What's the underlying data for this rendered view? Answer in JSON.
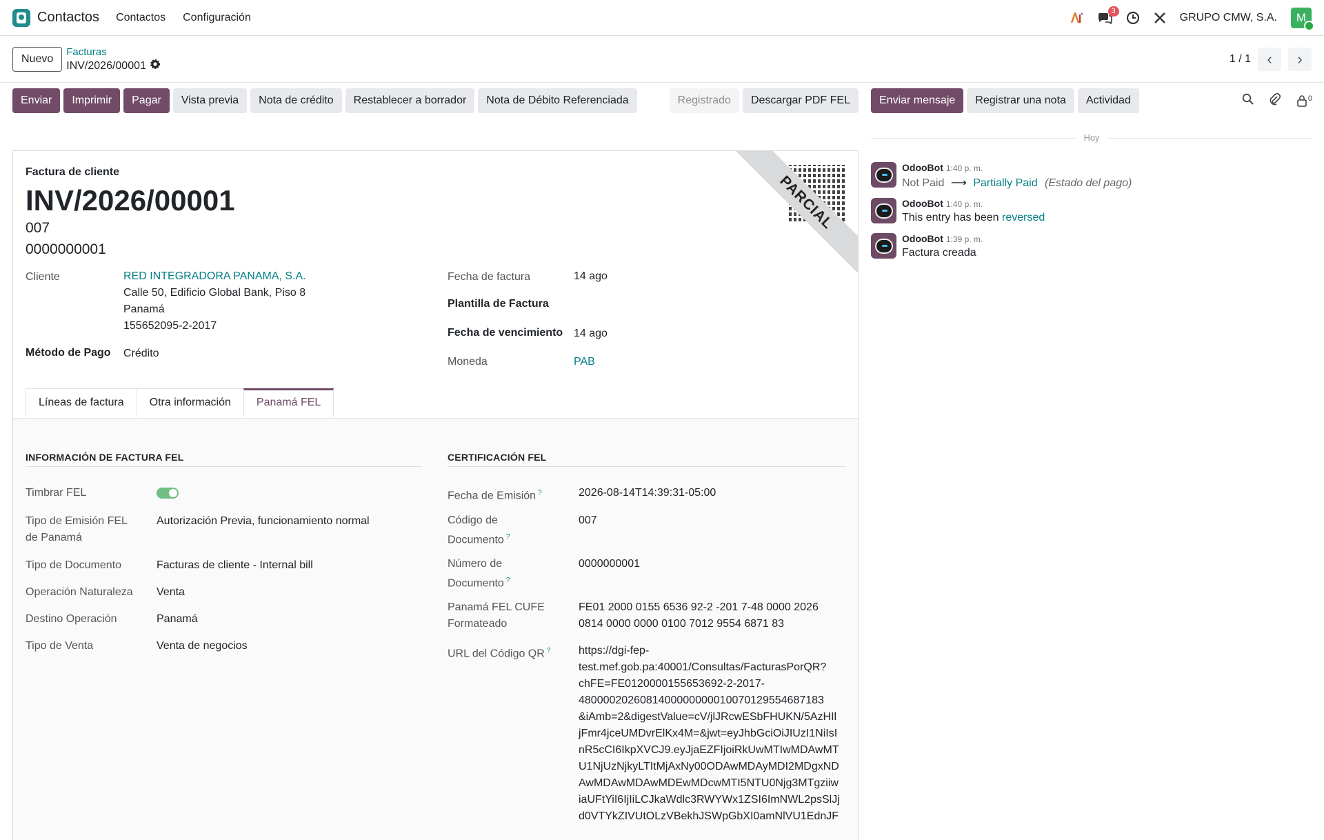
{
  "navbar": {
    "app_name": "Contactos",
    "menus": [
      "Contactos",
      "Configuración"
    ],
    "messages_badge": "3",
    "company": "GRUPO CMW, S.A.",
    "avatar_letter": "M"
  },
  "control": {
    "new_label": "Nuevo",
    "breadcrumb_parent": "Facturas",
    "breadcrumb_current": "INV/2026/00001",
    "pager": "1 / 1"
  },
  "actions": {
    "buttons": [
      "Enviar",
      "Imprimir",
      "Pagar",
      "Vista previa",
      "Nota de crédito",
      "Restablecer a borrador",
      "Nota de Débito Referenciada"
    ],
    "status": "Registrado",
    "download": "Descargar PDF FEL"
  },
  "invoice": {
    "ribbon": "PARCIAL",
    "doc_type": "Factura de cliente",
    "name": "INV/2026/00001",
    "code1": "007",
    "code2": "0000000001",
    "customer_label": "Cliente",
    "customer_name": "RED INTEGRADORA PANAMA, S.A.",
    "customer_addr1": "Calle 50, Edificio Global Bank, Piso 8",
    "customer_addr2": "Panamá",
    "customer_ruc": "155652095-2-2017",
    "payment_method_label": "Método de Pago",
    "payment_method": "Crédito",
    "invoice_date_label": "Fecha de factura",
    "invoice_date": "14 ago",
    "template_label": "Plantilla de Factura",
    "due_date_label": "Fecha de vencimiento",
    "due_date": "14 ago",
    "currency_label": "Moneda",
    "currency": "PAB"
  },
  "tabs": [
    "Líneas de factura",
    "Otra información",
    "Panamá FEL"
  ],
  "fel_info": {
    "title": "INFORMACIÓN DE FACTURA FEL",
    "timbrar_label": "Timbrar FEL",
    "emision_label1": "Tipo de Emisión FEL",
    "emision_label2": "de Panamá",
    "emision_value": "Autorización Previa, funcionamiento normal",
    "tipo_doc_label": "Tipo de Documento",
    "tipo_doc_value": "Facturas de cliente - Internal bill",
    "operacion_label": "Operación Naturaleza",
    "operacion_value": "Venta",
    "destino_label": "Destino Operación",
    "destino_value": "Panamá",
    "venta_label": "Tipo de Venta",
    "venta_value": "Venta de negocios"
  },
  "fel_cert": {
    "title": "CERTIFICACIÓN FEL",
    "fecha_label": "Fecha de Emisión",
    "fecha_value": "2026-08-14T14:39:31-05:00",
    "codigo_label1": "Código de",
    "codigo_label2": "Documento",
    "codigo_value": "007",
    "numero_label1": "Número de",
    "numero_label2": "Documento",
    "numero_value": "0000000001",
    "cufe_label1": "Panamá FEL CUFE",
    "cufe_label2": "Formateado",
    "cufe_line1": "FE01 2000 0155 6536 92-2 -201 7-48 0000 2026",
    "cufe_line2": "0814 0000 0000 0100 7012 9554 6871 83",
    "qr_label": "URL del Código QR",
    "help": "?",
    "qr_lines": [
      "https://dgi-fep-",
      "test.mef.gob.pa:40001/Consultas/FacturasPorQR?",
      "chFE=FE0120000155653692-2-2017-",
      "4800002026081400000000010070129554687183",
      "&iAmb=2&digestValue=cV/jlJRcwESbFHUKN/5AzHIl",
      "jFmr4jceUMDvrElKx4M=&jwt=eyJhbGciOiJIUzI1NiIsI",
      "nR5cCI6IkpXVCJ9.eyJjaEZFIjoiRkUwMTIwMDAwMT",
      "U1NjUzNjkyLTItMjAxNy00ODAwMDAyMDI2MDgxND",
      "AwMDAwMDAwMDEwMDcwMTI5NTU0Njg3MTgziiw",
      "iaUFtYiI6IjIiLCJkaWdlc3RWYWx1ZSI6ImNWL2psSlJj",
      "d0VTYkZIVUtOLzVBekhJSWpGbXI0amNlVU1EdnJF"
    ]
  },
  "chatter": {
    "send_message": "Enviar mensaje",
    "log_note": "Registrar una nota",
    "activity": "Actividad",
    "followers_count": "0",
    "day": "Hoy",
    "messages": [
      {
        "author": "OdooBot",
        "time": "1:40 p. m.",
        "from": "Not Paid",
        "to": "Partially Paid",
        "field": "(Estado del pago)"
      },
      {
        "author": "OdooBot",
        "time": "1:40 p. m.",
        "text": "This entry has been",
        "link": "reversed"
      },
      {
        "author": "OdooBot",
        "time": "1:39 p. m.",
        "text": "Factura creada"
      }
    ]
  }
}
